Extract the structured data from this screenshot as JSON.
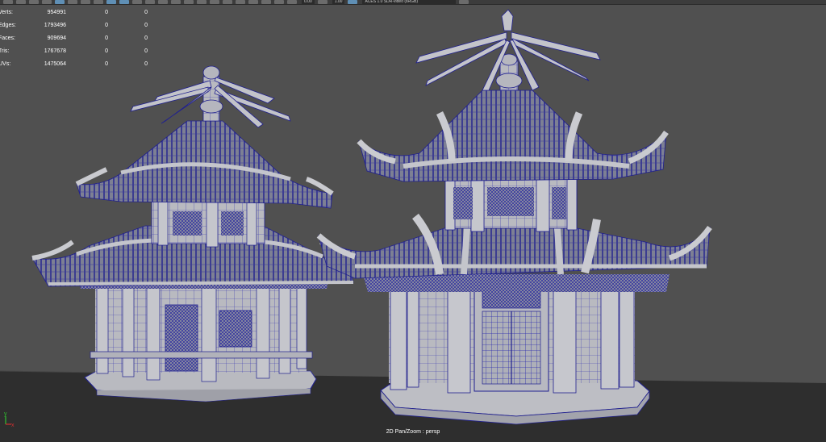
{
  "toolbar": {
    "field_1": "0.00",
    "field_2": "1.00",
    "color_management": "ACES 1.0 SDR-video (sRGB)"
  },
  "hud": {
    "rows": [
      {
        "label": "Verts:",
        "total": "954991",
        "selected": "0",
        "components": "0"
      },
      {
        "label": "Edges:",
        "total": "1793496",
        "selected": "0",
        "components": "0"
      },
      {
        "label": "Faces:",
        "total": "909694",
        "selected": "0",
        "components": "0"
      },
      {
        "label": "Tris:",
        "total": "1767678",
        "selected": "0",
        "components": "0"
      },
      {
        "label": "UVs:",
        "total": "1475064",
        "selected": "0",
        "components": "0"
      }
    ]
  },
  "viewport": {
    "camera_label": "2D Pan/Zoom : persp",
    "background_color": "#505050",
    "ground_color": "#2c2c2c",
    "wire_color": "#1a1aa8",
    "shade_color": "#b5b5b9"
  },
  "axis": {
    "x_label": "x",
    "y_label": "y",
    "x_color": "#d03030",
    "y_color": "#30c030"
  }
}
